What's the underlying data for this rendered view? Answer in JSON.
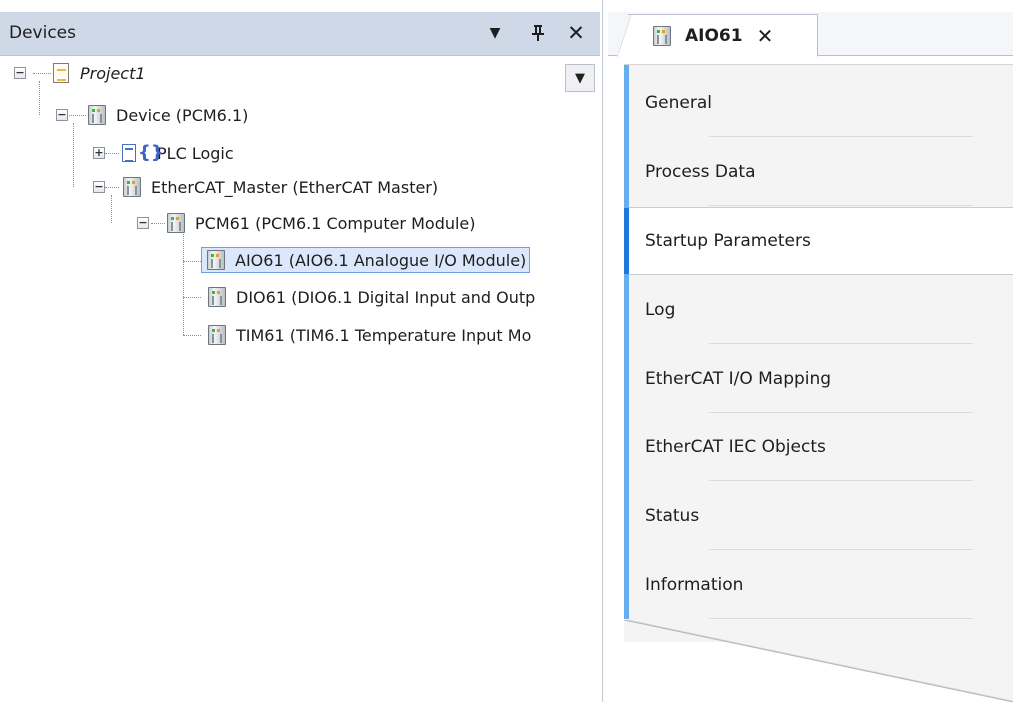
{
  "devices_panel": {
    "title": "Devices",
    "header_buttons": {
      "dropdown": "▼",
      "pin": "ᵻ",
      "close": "✕"
    },
    "scroll_dropdown": "▼"
  },
  "tree": {
    "project": "Project1",
    "device": "Device (PCM6.1)",
    "plc_logic": "PLC Logic",
    "ethercat_master": "EtherCAT_Master (EtherCAT Master)",
    "pcm61": "PCM61 (PCM6.1 Computer Module)",
    "aio61": "AIO61 (AIO6.1 Analogue I/O Module)",
    "dio61": "DIO61 (DIO6.1 Digital Input and Outp",
    "tim61": "TIM61 (TIM6.1 Temperature Input Mo",
    "expander_minus": "−",
    "expander_plus": "+"
  },
  "editor": {
    "tab_title": "AIO61",
    "tab_close": "✕",
    "side_tabs": [
      {
        "label": "General"
      },
      {
        "label": "Process Data"
      },
      {
        "label": "Startup Parameters"
      },
      {
        "label": "Log"
      },
      {
        "label": "EtherCAT I/O Mapping"
      },
      {
        "label": "EtherCAT IEC Objects"
      },
      {
        "label": "Status"
      },
      {
        "label": "Information"
      }
    ],
    "active_tab": "Startup Parameters"
  },
  "colors": {
    "header_bg": "#cfd8e7",
    "selection_bg": "#dbe8fb",
    "selection_border": "#6f9fe0",
    "accent_blue": "#66aef0"
  }
}
